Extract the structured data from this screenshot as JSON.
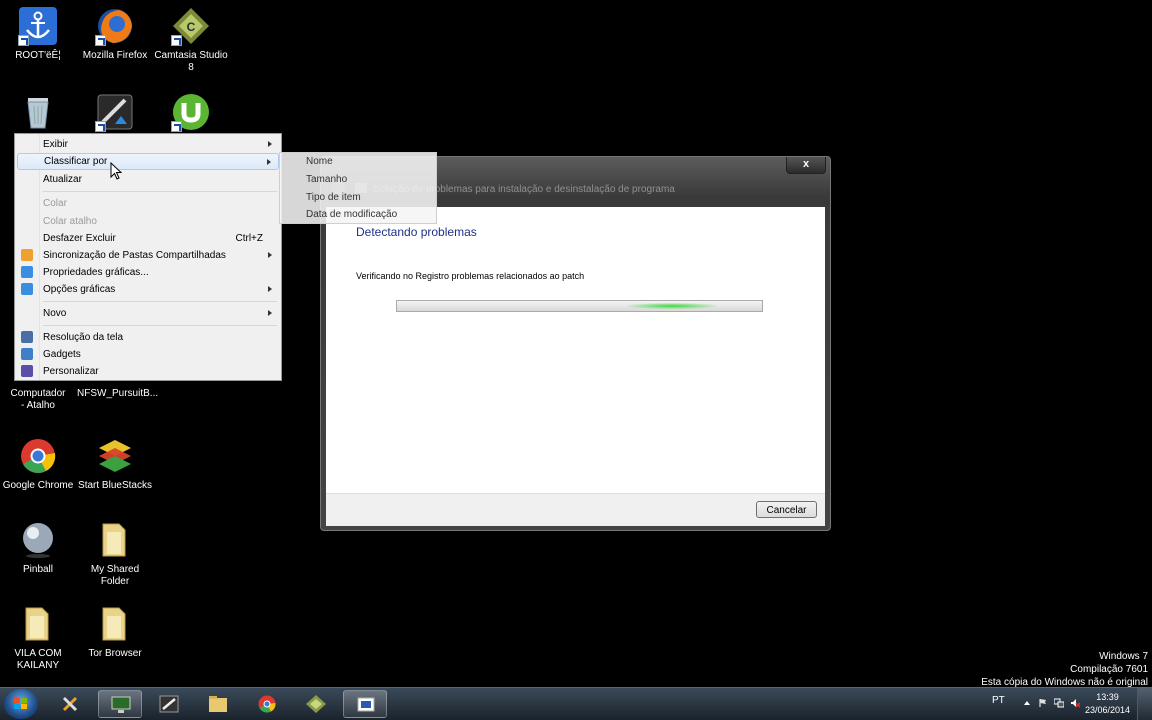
{
  "desktop_icons": [
    {
      "label": "ROOT'ëÊ¦"
    },
    {
      "label": "Mozilla Firefox"
    },
    {
      "label": "Camtasia Studio 8"
    },
    {
      "label": ""
    },
    {
      "label": ""
    },
    {
      "label": ""
    },
    {
      "label": "Computador - Atalho"
    },
    {
      "label": "NFSW_PursuitB..."
    },
    {
      "label": "Google Chrome"
    },
    {
      "label": "Start BlueStacks"
    },
    {
      "label": "Pinball"
    },
    {
      "label": "My Shared Folder"
    },
    {
      "label": "VILA COM KAILANY"
    },
    {
      "label": "Tor Browser"
    }
  ],
  "context_menu": {
    "items": [
      {
        "label": "Exibir"
      },
      {
        "label": "Classificar por"
      },
      {
        "label": "Atualizar"
      },
      {
        "label": "Colar"
      },
      {
        "label": "Colar atalho"
      },
      {
        "label": "Desfazer Excluir",
        "shortcut": "Ctrl+Z"
      },
      {
        "label": "Sincronização de Pastas Compartilhadas"
      },
      {
        "label": "Propriedades gráficas..."
      },
      {
        "label": "Opções gráficas"
      },
      {
        "label": "Novo"
      },
      {
        "label": "Resolução da tela"
      },
      {
        "label": "Gadgets"
      },
      {
        "label": "Personalizar"
      }
    ]
  },
  "submenu": {
    "items": [
      {
        "label": "Nome"
      },
      {
        "label": "Tamanho"
      },
      {
        "label": "Tipo de item"
      },
      {
        "label": "Data de modificação"
      }
    ]
  },
  "dialog": {
    "title": "Solução de problemas para instalação e desinstalação de programa",
    "close_label": "x",
    "heading": "Detectando problemas",
    "message": "Verificando no Registro problemas relacionados ao patch",
    "cancel_label": "Cancelar"
  },
  "watermark": {
    "line1": "Windows 7",
    "line2": "Compilação 7601",
    "line3": "Esta cópia do Windows não é original"
  },
  "taskbar": {
    "language": "PT",
    "time": "13:39",
    "date": "23/06/2014"
  },
  "colors": {
    "heading_blue": "#1e3287",
    "menu_bg": "#f0f0f0",
    "progress_green": "#3ddc3d"
  }
}
